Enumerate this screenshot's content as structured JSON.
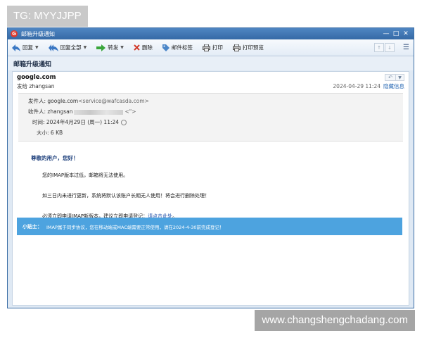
{
  "watermark_top": "TG: MYYJJPP",
  "watermark_bottom": "www.changshengchadang.com",
  "window": {
    "title": "邮箱升级通知",
    "controls": [
      "—",
      "□",
      "✕"
    ]
  },
  "toolbar": {
    "reply": "回复",
    "reply_all": "回复全部",
    "forward": "转发",
    "delete": "删除",
    "tag": "邮件标签",
    "print": "打印",
    "print_preview": "打印预览"
  },
  "subject": "邮箱升级通知",
  "message": {
    "from_name": "google.com",
    "to_line": "发给 zhangsan",
    "date_short": "2024-04-29 11:24",
    "hide_info": "隐藏信息",
    "sender_label": "发件人: google.com",
    "sender_addr": "<service@wafcasda.com>",
    "recipient_label": "收件人: zhangsan",
    "recipient_tail": "<\">",
    "time_label": "时间: 2024年4月29日 (周一) 11:24",
    "size_label": "大小: 6 KB"
  },
  "body": {
    "greeting": "尊敬的用户，您好！",
    "p1": "您的IMAP版本过低，邮箱将无法使用。",
    "p2": "如三日内未进行更新，系统将默认该账户长期无人使用！将会进行删除处理！",
    "p3_prefix": "必须立即申请IMAP新版本，建议立即申请登记：",
    "p3_link": "请点击此处",
    "p3_suffix": "。"
  },
  "tip": {
    "label": "小贴士：",
    "text": "IMAP属于同步协议，您在移动端或MAC端需要正常使用，请在2024-4-30前完成登记！"
  }
}
